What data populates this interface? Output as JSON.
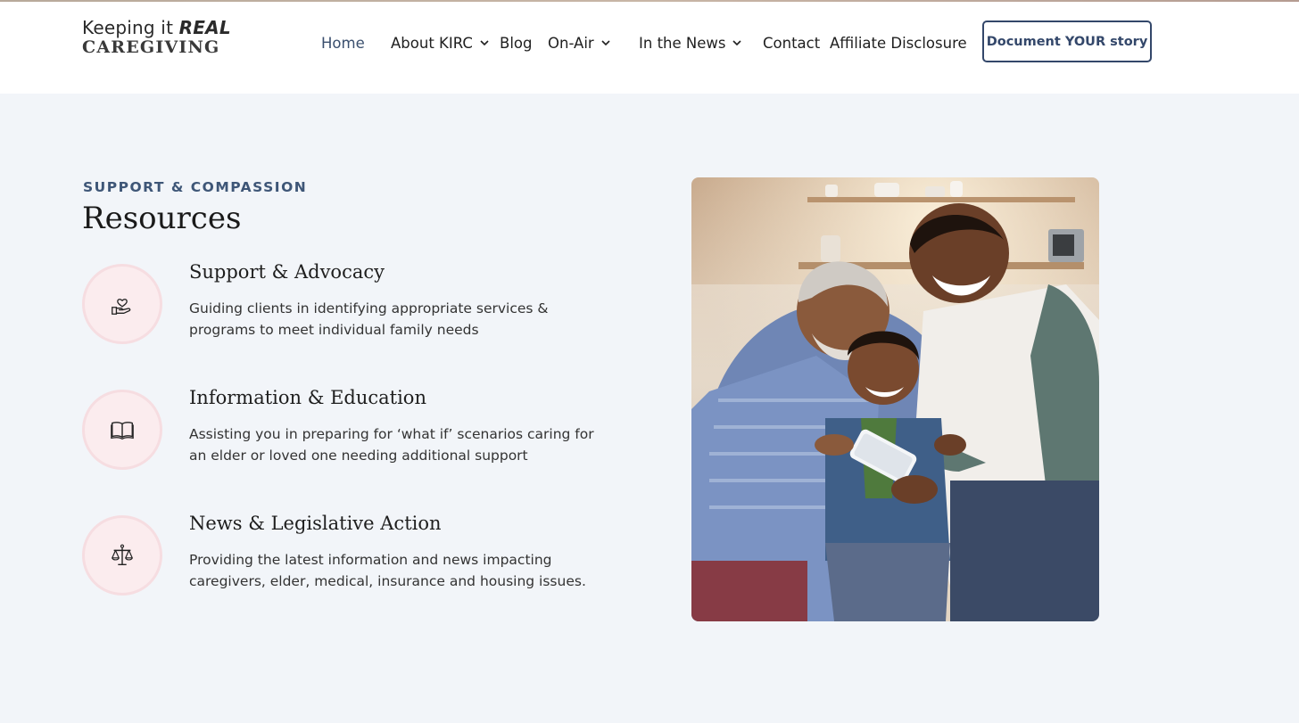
{
  "header": {
    "logo": {
      "line1_regular": "Keeping it ",
      "line1_emphasis": "REAL",
      "line2": "CAREGIVING"
    },
    "nav": [
      {
        "label": "Home",
        "active": true,
        "dropdown": false
      },
      {
        "label": "About KIRC",
        "active": false,
        "dropdown": true
      },
      {
        "label": "Blog",
        "active": false,
        "dropdown": false
      },
      {
        "label": "On-Air",
        "active": false,
        "dropdown": true
      },
      {
        "label": "In the News",
        "active": false,
        "dropdown": true
      },
      {
        "label": "Contact",
        "active": false,
        "dropdown": false
      },
      {
        "label": "Affiliate Disclosure",
        "active": false,
        "dropdown": false
      }
    ],
    "cta_label": "Document YOUR story"
  },
  "resources": {
    "eyebrow": "SUPPORT & COMPASSION",
    "title": "Resources",
    "items": [
      {
        "icon": "heart-hand-icon",
        "title": "Support & Advocacy",
        "description": "Guiding clients in identifying appropriate services & programs to meet individual family needs"
      },
      {
        "icon": "open-book-icon",
        "title": "Information & Education",
        "description": "Assisting you in preparing for ‘what if’ scenarios caring for an elder or loved one needing additional support"
      },
      {
        "icon": "scales-icon",
        "title": "News & Legislative Action",
        "description": "Providing the latest information and news impacting caregivers, elder, medical, insurance and housing issues."
      }
    ]
  },
  "colors": {
    "accent": "#3e5677",
    "nav_active": "#3a4f6e",
    "icon_circle": "#fbecee",
    "page_background": "#f2f5f9"
  }
}
